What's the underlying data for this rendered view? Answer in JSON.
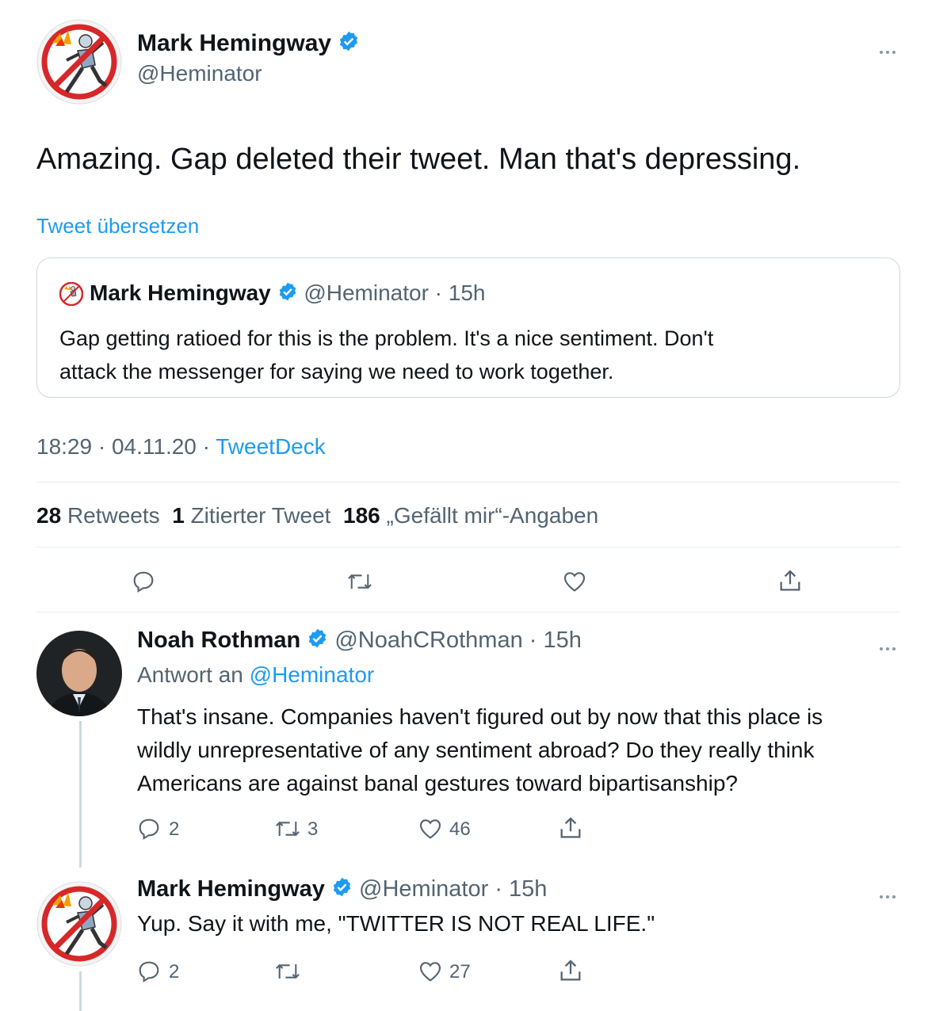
{
  "main_tweet": {
    "author_name": "Mark Hemingway",
    "handle": "@Heminator",
    "text": "Amazing. Gap deleted their tweet. Man that's depressing.",
    "translate_label": "Tweet übersetzen",
    "quoted": {
      "author_name": "Mark Hemingway",
      "handle_time": "@Heminator · 15h",
      "text_line1": "Gap getting ratioed for this is the problem. It's a nice sentiment. Don't",
      "text_line2": "attack the messenger for saying we need to work together."
    },
    "meta_time": "18:29 · 04.11.20 · ",
    "meta_source": "TweetDeck",
    "stats": {
      "retweets_count": "28",
      "retweets_label": "Retweets",
      "quotes_count": "1",
      "quotes_label": "Zitierter Tweet",
      "likes_count": "186",
      "likes_label": "„Gefällt mir“-Angaben"
    }
  },
  "replies": [
    {
      "author_name": "Noah Rothman",
      "handle_time": "@NoahCRothman · 15h",
      "reply_to_prefix": "Antwort an ",
      "reply_to_handle": "@Heminator",
      "text_line1": "That's insane. Companies haven't figured out by now that this place is",
      "text_line2": "wildly unrepresentative of any sentiment abroad? Do they really think",
      "text_line3": "Americans are against banal gestures toward bipartisanship?",
      "replies": "2",
      "retweets": "3",
      "likes": "46"
    },
    {
      "author_name": "Mark Hemingway",
      "handle_time": "@Heminator · 15h",
      "text": "Yup. Say it with me, \"TWITTER IS NOT REAL LIFE.\"",
      "replies": "2",
      "likes": "27"
    }
  ],
  "icons": [
    "more-icon",
    "verified-badge-icon",
    "reply-icon",
    "retweet-icon",
    "like-icon",
    "share-icon"
  ],
  "colors": {
    "accent": "#1d9bf0",
    "muted": "#536471",
    "border": "#e6ecf0"
  }
}
